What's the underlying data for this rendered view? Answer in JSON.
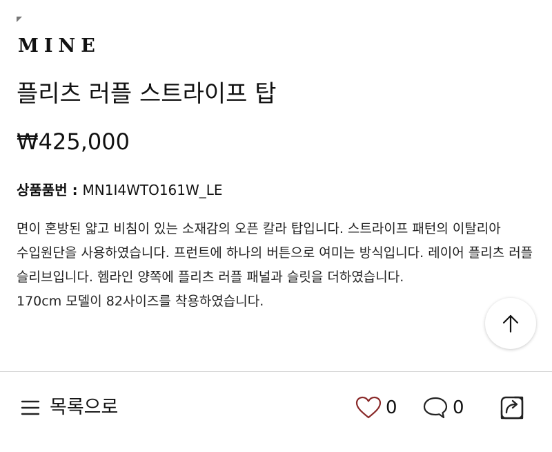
{
  "brand": {
    "name": "MINE"
  },
  "product": {
    "title": "플리츠 러플 스트라이프 탑",
    "price": "₩425,000",
    "code_label": "상품품번 : ",
    "code_value": "MN1I4WTO161W_LE",
    "description": [
      "면이 혼방된 얇고 비침이 있는 소재감의 오픈 칼라 탑입니다. 스트라이프 패턴의 이탈리아 수입원단을 사용하였습니다. 프런트에 하나의 버튼으로 여미는 방식입니다. 레이어 플리츠 러플 슬리브입니다. 헴라인 양쪽에 플리츠 러플 패널과 슬릿을 더하였습니다.",
      "170cm 모델이 82사이즈를 착용하였습니다."
    ]
  },
  "scroll_top": {
    "icon": "arrow-up-icon"
  },
  "bottom_bar": {
    "list_icon": "menu-icon",
    "list_label": "목록으로",
    "like_icon": "heart-icon",
    "like_count": "0",
    "like_color": "#8a2a2a",
    "comment_icon": "speech-bubble-icon",
    "comment_count": "0",
    "share_icon": "share-icon"
  }
}
